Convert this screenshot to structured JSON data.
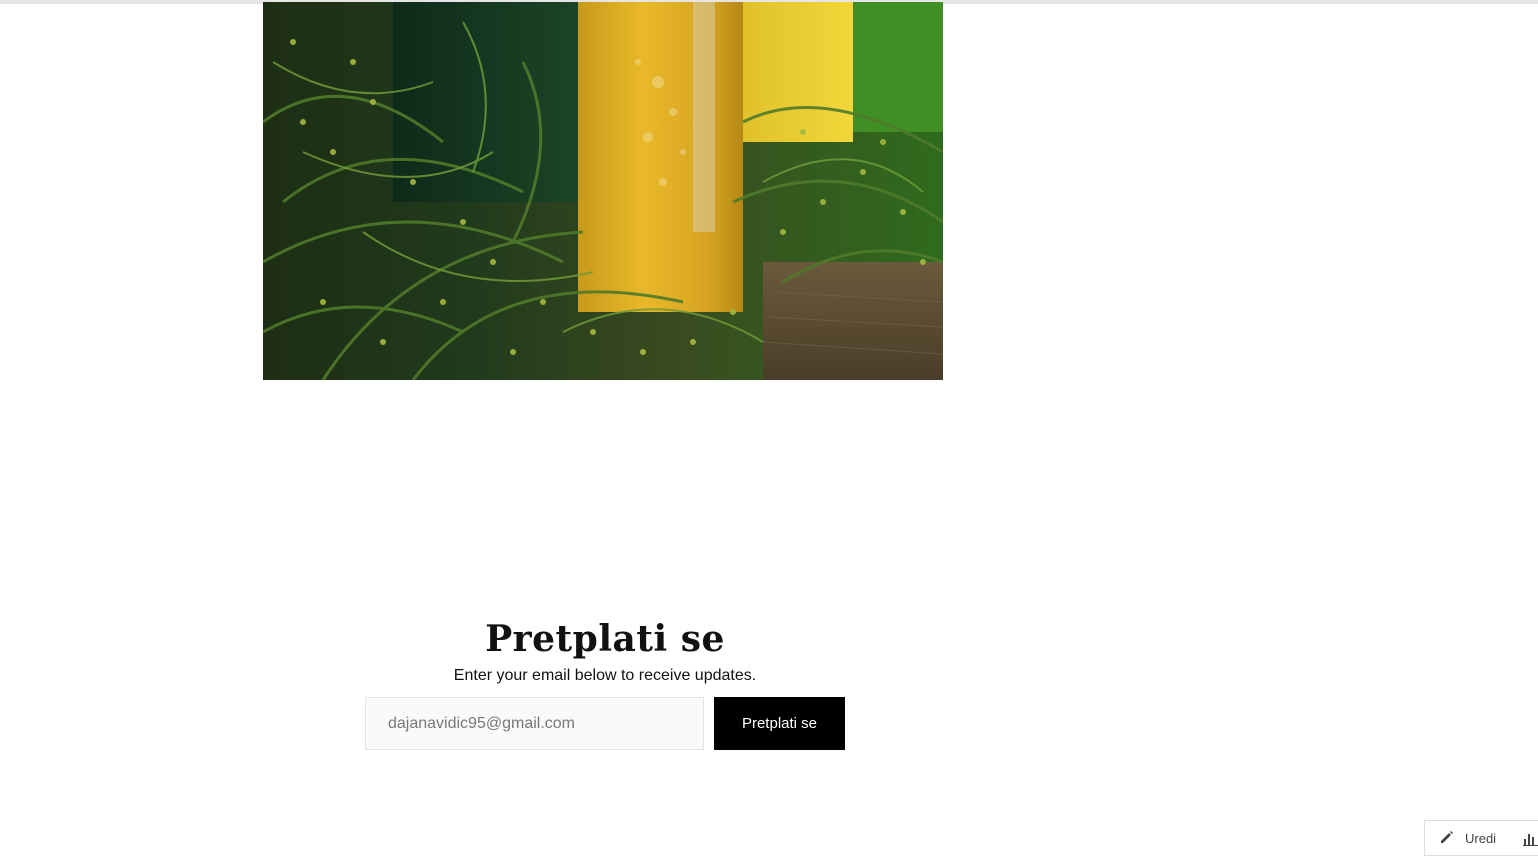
{
  "hero": {
    "image_alt": "Herbs and bottles of oil"
  },
  "subscribe": {
    "title": "Pretplati se",
    "subtitle": "Enter your email below to receive updates.",
    "email_value": "dajanavidic95@gmail.com",
    "button_label": "Pretplati se"
  },
  "edit_widget": {
    "edit_label": "Uredi",
    "edit_icon": "pencil-icon",
    "stats_icon": "bar-chart-icon"
  },
  "colors": {
    "button_bg": "#000000",
    "button_text": "#ffffff",
    "input_bg": "#fafafa"
  }
}
